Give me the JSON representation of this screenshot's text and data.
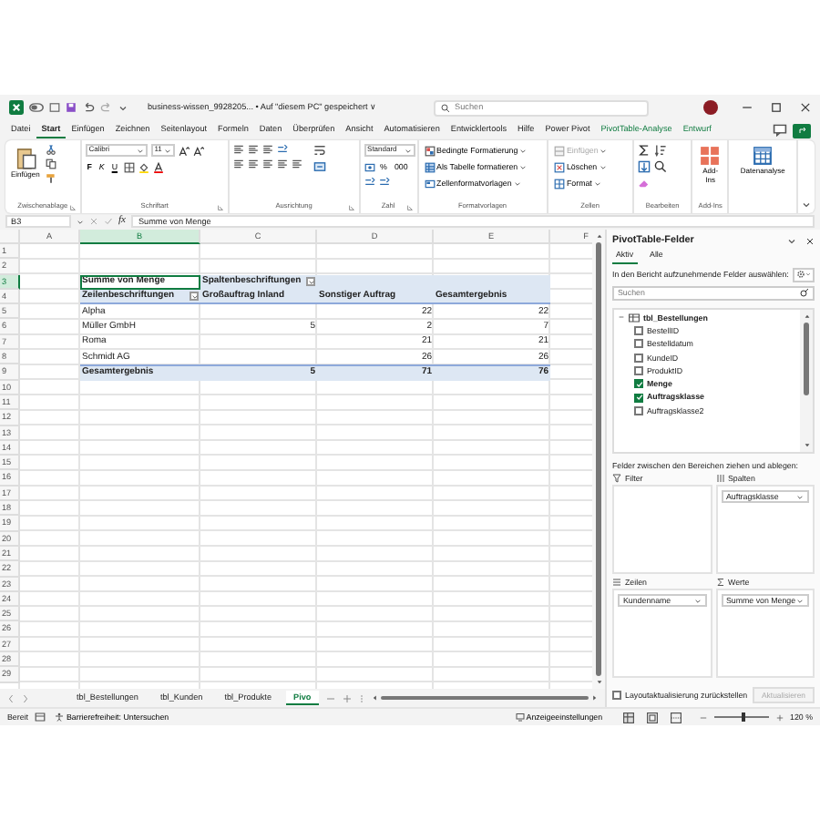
{
  "title_bar": {
    "document_title": "business-wissen_9928205... • Auf \"diesem PC\" gespeichert ∨",
    "search": {
      "placeholder": "Suchen"
    }
  },
  "menu_tabs": [
    {
      "label": "Datei",
      "selected": false,
      "kind": "normal"
    },
    {
      "label": "Start",
      "selected": true,
      "kind": "normal"
    },
    {
      "label": "Einfügen",
      "selected": false,
      "kind": "normal"
    },
    {
      "label": "Zeichnen",
      "selected": false,
      "kind": "normal"
    },
    {
      "label": "Seitenlayout",
      "selected": false,
      "kind": "normal"
    },
    {
      "label": "Formeln",
      "selected": false,
      "kind": "normal"
    },
    {
      "label": "Daten",
      "selected": false,
      "kind": "normal"
    },
    {
      "label": "Überprüfen",
      "selected": false,
      "kind": "normal"
    },
    {
      "label": "Ansicht",
      "selected": false,
      "kind": "normal"
    },
    {
      "label": "Automatisieren",
      "selected": false,
      "kind": "normal"
    },
    {
      "label": "Entwicklertools",
      "selected": false,
      "kind": "normal"
    },
    {
      "label": "Hilfe",
      "selected": false,
      "kind": "normal"
    },
    {
      "label": "Power Pivot",
      "selected": false,
      "kind": "normal"
    },
    {
      "label": "PivotTable-Analyse",
      "selected": false,
      "kind": "contextual"
    },
    {
      "label": "Entwurf",
      "selected": false,
      "kind": "contextual"
    }
  ],
  "ribbon": {
    "groups": [
      {
        "kind": "clipboard",
        "label": "Zwischenablage",
        "big_button": "Einfügen"
      },
      {
        "kind": "font",
        "label": "Schriftart",
        "font": "Calibri",
        "size": "11",
        "styles": [
          "F",
          "K",
          "U"
        ]
      },
      {
        "kind": "align",
        "label": "Ausrichtung"
      },
      {
        "kind": "number",
        "label": "Zahl",
        "format": "Standard",
        "symbols": [
          "%",
          "000"
        ]
      },
      {
        "kind": "styles",
        "label": "Formatvorlagen",
        "items": [
          "Bedingte Formatierung",
          "Als Tabelle formatieren",
          "Zellenformatvorlagen"
        ]
      },
      {
        "kind": "cells",
        "label": "Zellen",
        "items": [
          {
            "label": "Einfügen",
            "disabled": true
          },
          {
            "label": "Löschen",
            "disabled": false
          },
          {
            "label": "Format",
            "disabled": false
          }
        ]
      },
      {
        "kind": "edit",
        "label": "Bearbeiten"
      },
      {
        "kind": "addins",
        "label": "Add-Ins",
        "big_button": "Add-Ins"
      },
      {
        "kind": "analysis",
        "big_button": "Datenanalyse"
      }
    ]
  },
  "formula_bar": {
    "name_box": "B3",
    "function_symbol": "fx",
    "formula": "Summe von Menge"
  },
  "sheet": {
    "columns": [
      {
        "label": "A",
        "selected": false
      },
      {
        "label": "B",
        "selected": true
      },
      {
        "label": "C",
        "selected": false
      },
      {
        "label": "D",
        "selected": false
      },
      {
        "label": "E",
        "selected": false
      },
      {
        "label": "F",
        "selected": false
      }
    ],
    "rows": [
      {
        "header": "1",
        "selected": false
      },
      {
        "header": "2",
        "selected": false
      },
      {
        "header": "3",
        "selected": true
      },
      {
        "header": "4",
        "selected": false
      },
      {
        "header": "5",
        "selected": false
      },
      {
        "header": "6",
        "selected": false
      },
      {
        "header": "7",
        "selected": false
      },
      {
        "header": "8",
        "selected": false
      },
      {
        "header": "9",
        "selected": false
      },
      {
        "header": "10",
        "selected": false
      },
      {
        "header": "11",
        "selected": false
      },
      {
        "header": "12",
        "selected": false
      },
      {
        "header": "13",
        "selected": false
      },
      {
        "header": "14",
        "selected": false
      },
      {
        "header": "15",
        "selected": false
      },
      {
        "header": "16",
        "selected": false
      },
      {
        "header": "17",
        "selected": false
      },
      {
        "header": "18",
        "selected": false
      },
      {
        "header": "19",
        "selected": false
      },
      {
        "header": "20",
        "selected": false
      },
      {
        "header": "21",
        "selected": false
      },
      {
        "header": "22",
        "selected": false
      },
      {
        "header": "23",
        "selected": false
      },
      {
        "header": "24",
        "selected": false
      },
      {
        "header": "25",
        "selected": false
      },
      {
        "header": "26",
        "selected": false
      },
      {
        "header": "27",
        "selected": false
      },
      {
        "header": "28",
        "selected": false
      },
      {
        "header": "29",
        "selected": false
      }
    ],
    "pivot": {
      "value_field": {
        "text": "Summe von Menge",
        "selected": true
      },
      "column_label": {
        "text": "Spaltenbeschriftungen",
        "filter": true
      },
      "row_label": {
        "text": "Zeilenbeschriftungen",
        "filter": true
      },
      "column_items": [
        "Großauftrag Inland",
        "Sonstiger Auftrag",
        "Gesamtergebnis"
      ],
      "rows": [
        {
          "label": "Alpha",
          "sonstiger_auftrag": "22",
          "gesamtergebnis": "22"
        },
        {
          "label": "Müller GmbH",
          "grossauftrag_inland": "5",
          "sonstiger_auftrag": "2",
          "gesamtergebnis": "7"
        },
        {
          "label": "Roma",
          "sonstiger_auftrag": "21",
          "gesamtergebnis": "21"
        },
        {
          "label": "Schmidt AG",
          "sonstiger_auftrag": "26",
          "gesamtergebnis": "26"
        }
      ],
      "total": {
        "label": "Gesamtergebnis",
        "grossauftrag_inland": "5",
        "sonstiger_auftrag": "71",
        "gesamtergebnis": "76"
      }
    }
  },
  "sheet_tabs": [
    {
      "label": "tbl_Bestellungen",
      "selected": false
    },
    {
      "label": "tbl_Kunden",
      "selected": false
    },
    {
      "label": "tbl_Produkte",
      "selected": false
    },
    {
      "label": "Pivo",
      "selected": true
    }
  ],
  "pivot_panel": {
    "title": "PivotTable-Felder",
    "tabs": [
      {
        "label": "Aktiv",
        "selected": true
      },
      {
        "label": "Alle",
        "selected": false
      }
    ],
    "prompt": "In den Bericht aufzunehmende Felder auswählen:",
    "search": {
      "placeholder": "Suchen"
    },
    "tables": [
      {
        "name": "tbl_Bestellungen",
        "expanded": true,
        "children": [
          {
            "name": "BestellID",
            "checked": false
          },
          {
            "name": "Bestelldatum",
            "checked": false
          },
          {
            "name": "KundeID",
            "checked": false
          },
          {
            "name": "ProduktID",
            "checked": false
          },
          {
            "name": "Menge",
            "checked": true
          },
          {
            "name": "Auftragsklasse",
            "checked": true
          },
          {
            "name": "Auftragsklasse2",
            "checked": false
          }
        ]
      }
    ],
    "areas_hint": "Felder zwischen den Bereichen ziehen und ablegen:",
    "areas": [
      {
        "kind": "filter",
        "label": "Filter"
      },
      {
        "kind": "columns",
        "label": "Spalten",
        "fields": [
          "Auftragsklasse"
        ]
      },
      {
        "kind": "rows",
        "label": "Zeilen",
        "fields": [
          "Kundenname"
        ]
      },
      {
        "kind": "values",
        "label": "Werte",
        "fields": [
          "Summe von Menge"
        ]
      }
    ],
    "defer": {
      "label": "Layoutaktualisierung zurückstellen",
      "checked": false
    },
    "update_button": {
      "label": "Aktualisieren",
      "disabled": true
    }
  },
  "status_bar": {
    "mode": "Bereit",
    "accessibility": "Barrierefreiheit: Untersuchen",
    "display_settings": "Anzeigeeinstellungen",
    "zoom": {
      "level": 0.55,
      "reading": "120 %"
    }
  }
}
